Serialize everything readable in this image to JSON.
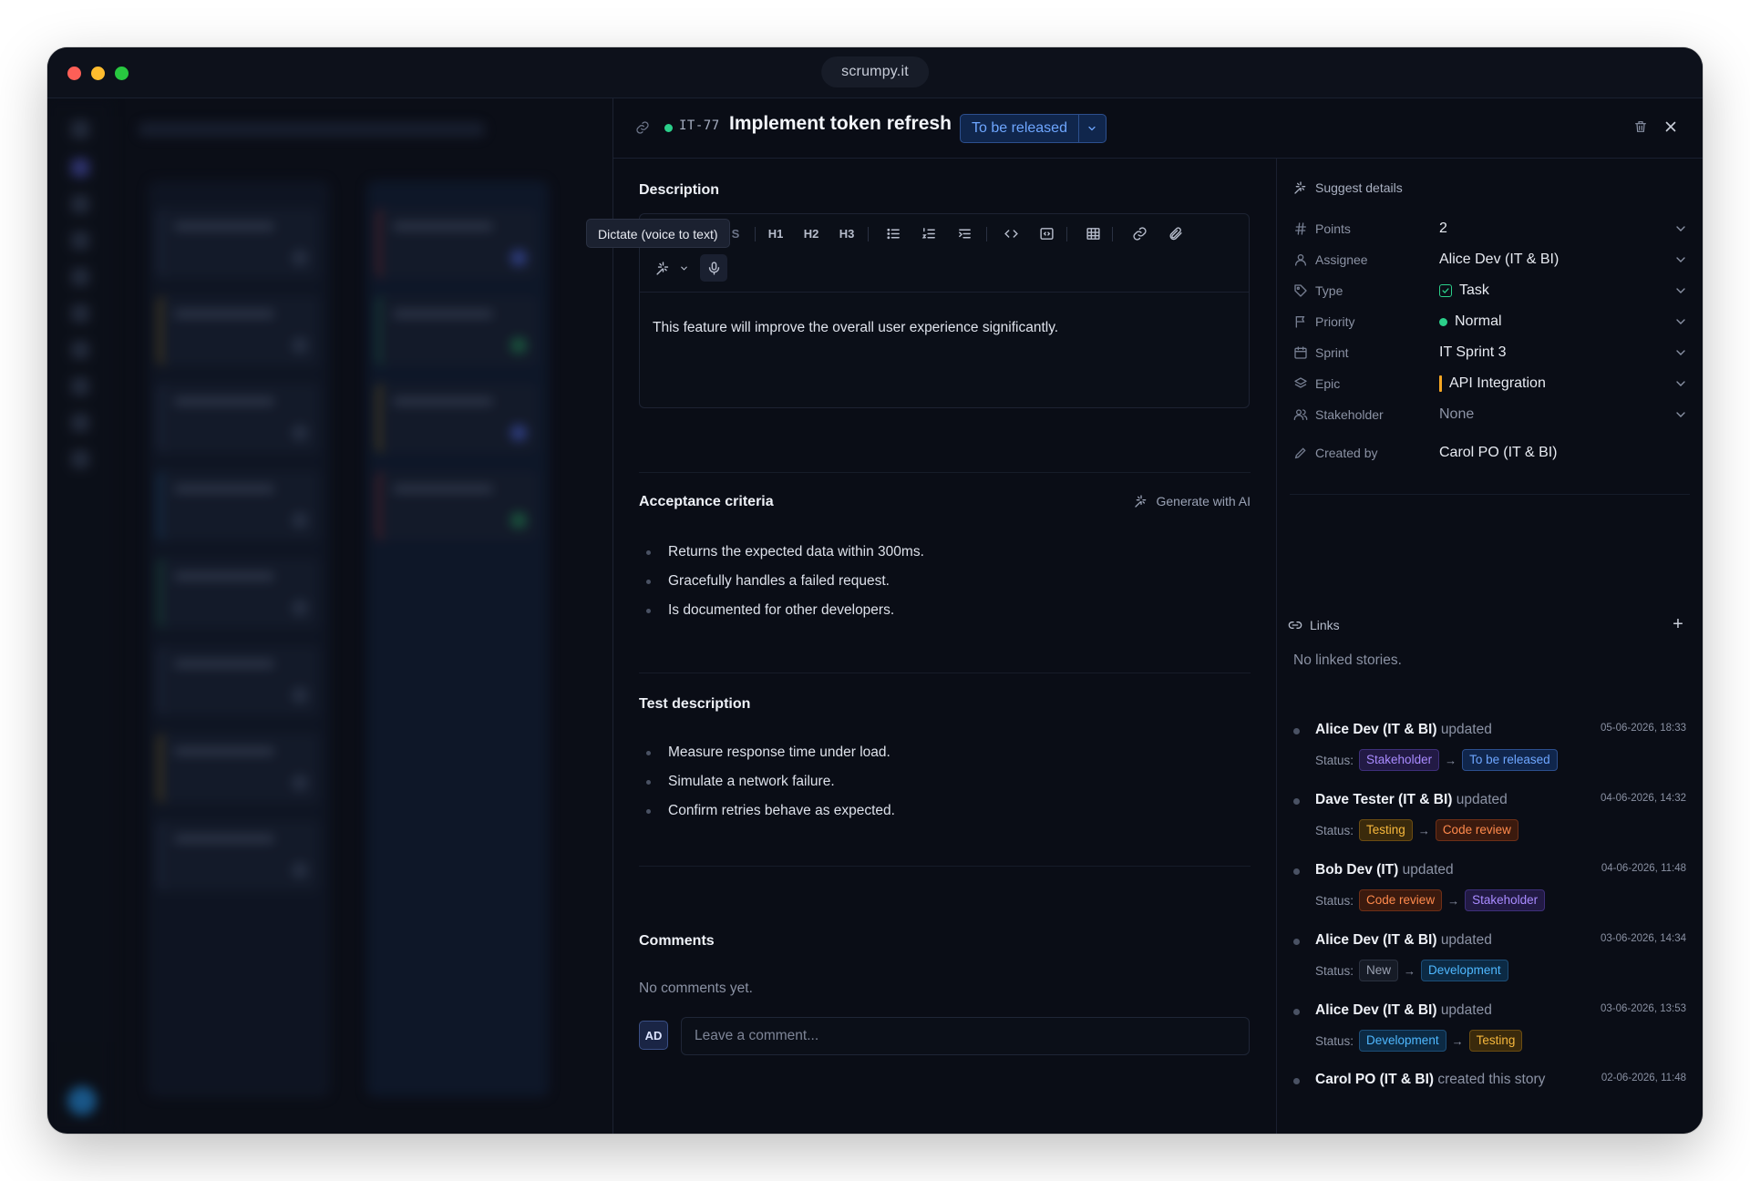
{
  "browser": {
    "url": "scrumpy.it"
  },
  "story": {
    "key": "IT-77",
    "title": "Implement token refresh",
    "status_label": "To be released"
  },
  "description": {
    "heading": "Description",
    "tooltip": "Dictate (voice to text)",
    "toolbar": {
      "h1": "H1",
      "h2": "H2",
      "h3": "H3"
    },
    "text": "This feature will improve the overall user experience significantly."
  },
  "acceptance": {
    "heading": "Acceptance criteria",
    "generate_label": "Generate with AI",
    "items": [
      "Returns the expected data within 300ms.",
      "Gracefully handles a failed request.",
      "Is documented for other developers."
    ]
  },
  "test": {
    "heading": "Test description",
    "items": [
      "Measure response time under load.",
      "Simulate a network failure.",
      "Confirm retries behave as expected."
    ]
  },
  "comments": {
    "heading": "Comments",
    "empty_text": "No comments yet.",
    "avatar_initials": "AD",
    "placeholder": "Leave a comment..."
  },
  "details": {
    "suggest_label": "Suggest details",
    "fields": {
      "points": {
        "label": "Points",
        "value": "2"
      },
      "assignee": {
        "label": "Assignee",
        "value": "Alice Dev (IT & BI)"
      },
      "type": {
        "label": "Type",
        "value": "Task"
      },
      "priority": {
        "label": "Priority",
        "value": "Normal"
      },
      "sprint": {
        "label": "Sprint",
        "value": "IT Sprint 3"
      },
      "epic": {
        "label": "Epic",
        "value": "API Integration"
      },
      "stakeholder": {
        "label": "Stakeholder",
        "value": "None"
      },
      "created_by": {
        "label": "Created by",
        "value": "Carol PO (IT & BI)"
      }
    }
  },
  "links": {
    "label": "Links",
    "empty_text": "No linked stories.",
    "add_label": "+"
  },
  "activity": {
    "status_prefix": "Status:",
    "arrow": "→",
    "items": [
      {
        "who": "Alice Dev (IT & BI)",
        "verb": "updated",
        "time": "05-06-2026, 18:33",
        "from": "Stakeholder",
        "to": "To be released"
      },
      {
        "who": "Dave Tester (IT & BI)",
        "verb": "updated",
        "time": "04-06-2026, 14:32",
        "from": "Testing",
        "to": "Code review"
      },
      {
        "who": "Bob Dev (IT)",
        "verb": "updated",
        "time": "04-06-2026, 11:48",
        "from": "Code review",
        "to": "Stakeholder"
      },
      {
        "who": "Alice Dev (IT & BI)",
        "verb": "updated",
        "time": "03-06-2026, 14:34",
        "from": "New",
        "to": "Development"
      },
      {
        "who": "Alice Dev (IT & BI)",
        "verb": "updated",
        "time": "03-06-2026, 13:53",
        "from": "Development",
        "to": "Testing"
      },
      {
        "who": "Carol PO (IT & BI)",
        "verb": "created this story",
        "time": "02-06-2026, 11:48"
      }
    ]
  },
  "colors": {
    "accent_blue": "#6ea6ff",
    "status_green": "#2bcf8a",
    "epic_orange": "#f5a623",
    "background": "#0a0d16"
  }
}
